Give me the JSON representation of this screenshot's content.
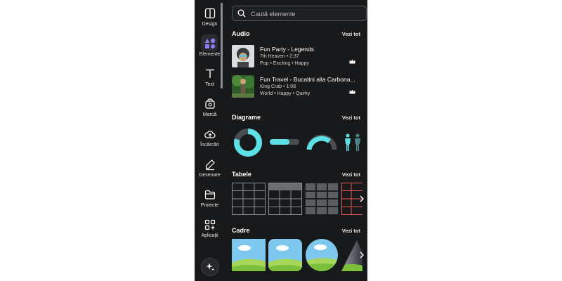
{
  "sidebar": {
    "items": [
      {
        "label": "Design",
        "icon": "design-layout-icon"
      },
      {
        "label": "Elemente",
        "icon": "elements-shapes-icon"
      },
      {
        "label": "Text",
        "icon": "text-t-icon"
      },
      {
        "label": "Marcă",
        "icon": "brand-kit-icon"
      },
      {
        "label": "Încărcări",
        "icon": "cloud-upload-icon"
      },
      {
        "label": "Desenare",
        "icon": "draw-pen-icon"
      },
      {
        "label": "Proiecte",
        "icon": "folder-icon"
      },
      {
        "label": "Aplicații",
        "icon": "apps-grid-icon"
      }
    ],
    "magic_icon": "sparkle-magic-icon"
  },
  "search": {
    "placeholder": "Caută elemente"
  },
  "sections": {
    "audio": {
      "title": "Audio",
      "see_all": "Vezi tot"
    },
    "diagrams": {
      "title": "Diagrame",
      "see_all": "Vezi tot"
    },
    "tables": {
      "title": "Tabele",
      "see_all": "Vezi tot"
    },
    "frames": {
      "title": "Cadre",
      "see_all": "Vezi tot"
    }
  },
  "audio": [
    {
      "title": "Fun Party - Legends",
      "meta": "7th Heaven • 2:37",
      "tags": "Pop • Exciting • Happy",
      "premium_icon": "crown-icon"
    },
    {
      "title": "Fun Travel - Bucatini alla Carbona...",
      "meta": "King Crab • 1:08",
      "tags": "World • Happy • Quirky",
      "premium_icon": "crown-icon"
    }
  ],
  "colors": {
    "background": "#18191b",
    "accent": "#5ce1e6",
    "table_dark": "#4a4a4a",
    "table_red": "#e55b5b",
    "sky": "#7ec8f0",
    "grass": "#7cbf3a"
  }
}
